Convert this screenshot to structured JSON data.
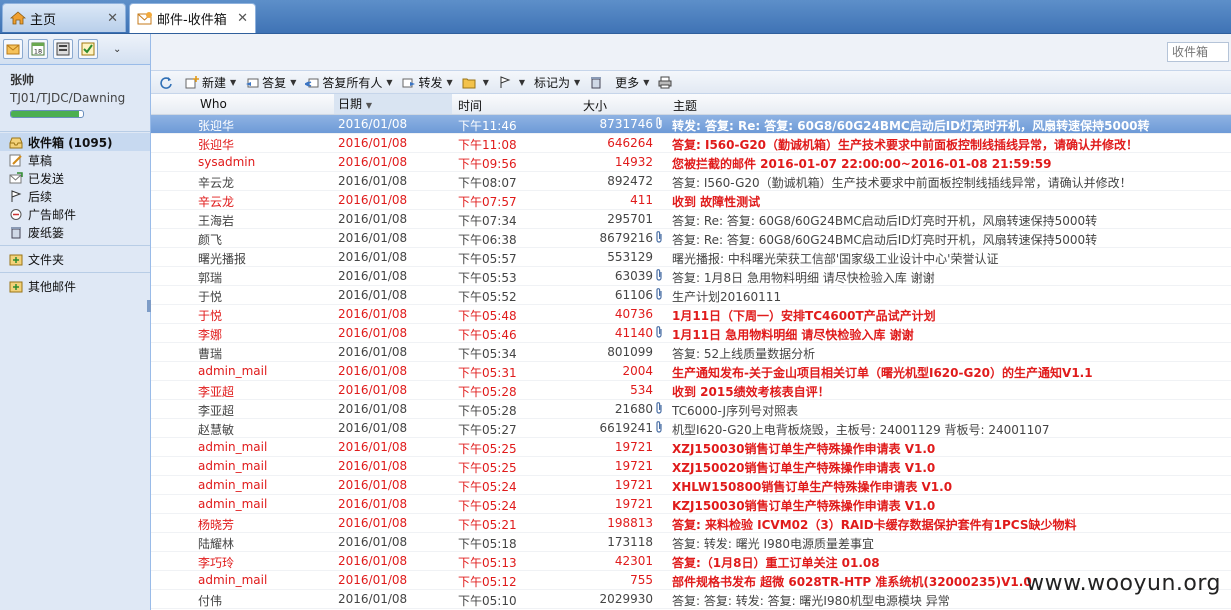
{
  "tabs": [
    {
      "label": "主页",
      "icon": "home-icon"
    },
    {
      "label": "邮件-收件箱",
      "icon": "mail-icon"
    }
  ],
  "sidebar": {
    "user_name": "张帅",
    "user_org": "TJ01/TJDC/Dawning",
    "quota_fraction": 0.95,
    "folders": [
      {
        "label": "收件箱 (1095)",
        "icon": "inbox-icon"
      },
      {
        "label": "草稿",
        "icon": "draft-icon"
      },
      {
        "label": "已发送",
        "icon": "sent-icon"
      },
      {
        "label": "后续",
        "icon": "flag-icon"
      },
      {
        "label": "广告邮件",
        "icon": "ad-mail-icon"
      },
      {
        "label": "废纸篓",
        "icon": "trash-icon"
      }
    ],
    "folders_section": "文件夹",
    "other_section": "其他邮件"
  },
  "search": {
    "placeholder": "收件箱"
  },
  "toolbar": {
    "new": "新建",
    "reply": "答复",
    "reply_all": "答复所有人",
    "forward": "转发",
    "mark_as": "标记为",
    "more": "更多"
  },
  "columns": {
    "who": "Who",
    "date": "日期",
    "time": "时间",
    "size": "大小",
    "subject": "主题"
  },
  "rows": [
    {
      "who": "张迎华",
      "date": "2016/01/08",
      "time": "下午11:46",
      "size": "8731746",
      "att": true,
      "subject": "转发: 答复: Re: 答复: 60G8/60G24BMC启动后ID灯亮时开机，风扇转速保持5000转",
      "style": "sel"
    },
    {
      "who": "张迎华",
      "date": "2016/01/08",
      "time": "下午11:08",
      "size": "646264",
      "att": false,
      "subject": "答复: I560-G20（勤诚机箱）生产技术要求中前面板控制线插线异常，请确认并修改！",
      "style": "red"
    },
    {
      "who": "sysadmin",
      "date": "2016/01/08",
      "time": "下午09:56",
      "size": "14932",
      "att": false,
      "subject": "您被拦截的邮件 2016-01-07 22:00:00~2016-01-08 21:59:59",
      "style": "red"
    },
    {
      "who": "辛云龙",
      "date": "2016/01/08",
      "time": "下午08:07",
      "size": "892472",
      "att": false,
      "subject": "答复: I560-G20（勤诚机箱）生产技术要求中前面板控制线插线异常，请确认并修改！",
      "style": "norm"
    },
    {
      "who": "辛云龙",
      "date": "2016/01/08",
      "time": "下午07:57",
      "size": "411",
      "att": false,
      "subject": "收到 故障性测试",
      "style": "red"
    },
    {
      "who": "王海岩",
      "date": "2016/01/08",
      "time": "下午07:34",
      "size": "295701",
      "att": false,
      "subject": "答复: Re: 答复: 60G8/60G24BMC启动后ID灯亮时开机，风扇转速保持5000转",
      "style": "norm"
    },
    {
      "who": "颜飞",
      "date": "2016/01/08",
      "time": "下午06:38",
      "size": "8679216",
      "att": true,
      "subject": "答复: Re: 答复: 60G8/60G24BMC启动后ID灯亮时开机，风扇转速保持5000转",
      "style": "norm"
    },
    {
      "who": "曙光播报",
      "date": "2016/01/08",
      "time": "下午05:57",
      "size": "553129",
      "att": false,
      "subject": "曙光播报: 中科曙光荣获工信部'国家级工业设计中心'荣誉认证",
      "style": "norm"
    },
    {
      "who": "郭瑞",
      "date": "2016/01/08",
      "time": "下午05:53",
      "size": "63039",
      "att": true,
      "subject": "答复: 1月8日 急用物料明细 请尽快检验入库 谢谢",
      "style": "norm"
    },
    {
      "who": "于悦",
      "date": "2016/01/08",
      "time": "下午05:52",
      "size": "61106",
      "att": true,
      "subject": "生产计划20160111",
      "style": "norm"
    },
    {
      "who": "于悦",
      "date": "2016/01/08",
      "time": "下午05:48",
      "size": "40736",
      "att": false,
      "subject": "1月11日（下周一）安排TC4600T产品试产计划",
      "style": "red"
    },
    {
      "who": "李娜",
      "date": "2016/01/08",
      "time": "下午05:46",
      "size": "41140",
      "att": true,
      "subject": "1月11日 急用物料明细 请尽快检验入库 谢谢",
      "style": "red"
    },
    {
      "who": "曹瑞",
      "date": "2016/01/08",
      "time": "下午05:34",
      "size": "801099",
      "att": false,
      "subject": "答复: 52上线质量数据分析",
      "style": "norm"
    },
    {
      "who": "admin_mail",
      "date": "2016/01/08",
      "time": "下午05:31",
      "size": "2004",
      "att": false,
      "subject": "生产通知发布-关于金山项目相关订单（曙光机型I620-G20）的生产通知V1.1",
      "style": "red"
    },
    {
      "who": "李亚超",
      "date": "2016/01/08",
      "time": "下午05:28",
      "size": "534",
      "att": false,
      "subject": "收到 2015绩效考核表自评！",
      "style": "red"
    },
    {
      "who": "李亚超",
      "date": "2016/01/08",
      "time": "下午05:28",
      "size": "21680",
      "att": true,
      "subject": "TC6000-J序列号对照表",
      "style": "norm"
    },
    {
      "who": "赵慧敏",
      "date": "2016/01/08",
      "time": "下午05:27",
      "size": "6619241",
      "att": true,
      "subject": "机型I620-G20上电背板烧毁，主板号: 24001129 背板号: 24001107",
      "style": "norm"
    },
    {
      "who": "admin_mail",
      "date": "2016/01/08",
      "time": "下午05:25",
      "size": "19721",
      "att": false,
      "subject": "XZJ150030销售订单生产特殊操作申请表 V1.0",
      "style": "red"
    },
    {
      "who": "admin_mail",
      "date": "2016/01/08",
      "time": "下午05:25",
      "size": "19721",
      "att": false,
      "subject": "XZJ150020销售订单生产特殊操作申请表 V1.0",
      "style": "red"
    },
    {
      "who": "admin_mail",
      "date": "2016/01/08",
      "time": "下午05:24",
      "size": "19721",
      "att": false,
      "subject": "XHLW150800销售订单生产特殊操作申请表 V1.0",
      "style": "red"
    },
    {
      "who": "admin_mail",
      "date": "2016/01/08",
      "time": "下午05:24",
      "size": "19721",
      "att": false,
      "subject": "KZJ150030销售订单生产特殊操作申请表 V1.0",
      "style": "red"
    },
    {
      "who": "杨晓芳",
      "date": "2016/01/08",
      "time": "下午05:21",
      "size": "198813",
      "att": false,
      "subject": "答复: 来料检验 ICVM02（3）RAID卡缓存数据保护套件有1PCS缺少物料",
      "style": "red"
    },
    {
      "who": "陆耀林",
      "date": "2016/01/08",
      "time": "下午05:18",
      "size": "173118",
      "att": false,
      "subject": "答复: 转发: 曙光 I980电源质量差事宜",
      "style": "norm"
    },
    {
      "who": "李巧玲",
      "date": "2016/01/08",
      "time": "下午05:13",
      "size": "42301",
      "att": false,
      "subject": "答复:（1月8日）重工订单关注 01.08",
      "style": "red"
    },
    {
      "who": "admin_mail",
      "date": "2016/01/08",
      "time": "下午05:12",
      "size": "755",
      "att": false,
      "subject": "部件规格书发布 超微 6028TR-HTP 准系统机(32000235)V1.0",
      "style": "red"
    },
    {
      "who": "付伟",
      "date": "2016/01/08",
      "time": "下午05:10",
      "size": "2029930",
      "att": false,
      "subject": "答复: 答复: 转发: 答复: 曙光I980机型电源模块 异常",
      "style": "norm"
    }
  ],
  "watermark": "www.wooyun.org",
  "colors": {
    "accent": "#3f73b5",
    "unread": "#e01b1b",
    "selected": "#7da5dd"
  }
}
